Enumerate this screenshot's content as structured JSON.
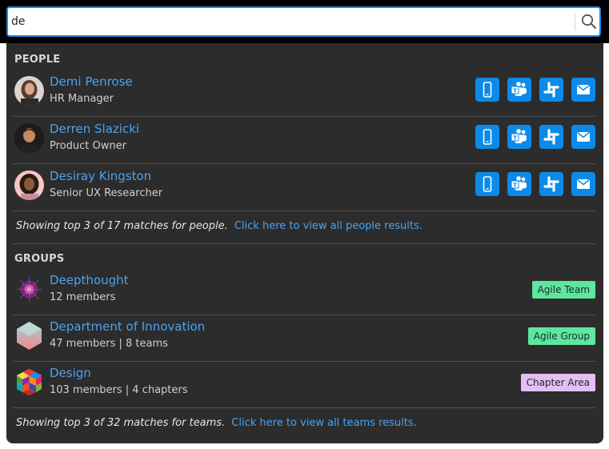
{
  "search": {
    "value": "de"
  },
  "people": {
    "title": "PEOPLE",
    "items": [
      {
        "name": "Demi Penrose",
        "role": "HR Manager"
      },
      {
        "name": "Derren Slazicki",
        "role": "Product Owner"
      },
      {
        "name": "Desiray Kingston",
        "role": "Senior UX Researcher"
      }
    ],
    "actions": [
      "phone-icon",
      "teams-icon",
      "slack-icon",
      "mail-icon"
    ],
    "footer_count": "Showing top 3 of 17 matches for people.",
    "footer_link": "Click here to view all people results."
  },
  "groups": {
    "title": "GROUPS",
    "items": [
      {
        "name": "Deepthought",
        "meta": "12 members",
        "badge": "Agile Team",
        "badge_color": "#5ee6a0"
      },
      {
        "name": "Department of Innovation",
        "meta": "47 members | 8 teams",
        "badge": "Agile Group",
        "badge_color": "#5ee6a0"
      },
      {
        "name": "Design",
        "meta": "103 members | 4 chapters",
        "badge": "Chapter Area",
        "badge_color": "#e4bff5"
      }
    ],
    "footer_count": "Showing top 3 of 32 matches for teams.",
    "footer_link": "Click here to view all teams results."
  },
  "colors": {
    "accent": "#0d8ae8",
    "link": "#4aa3ef",
    "panel": "#2c2c2c"
  }
}
